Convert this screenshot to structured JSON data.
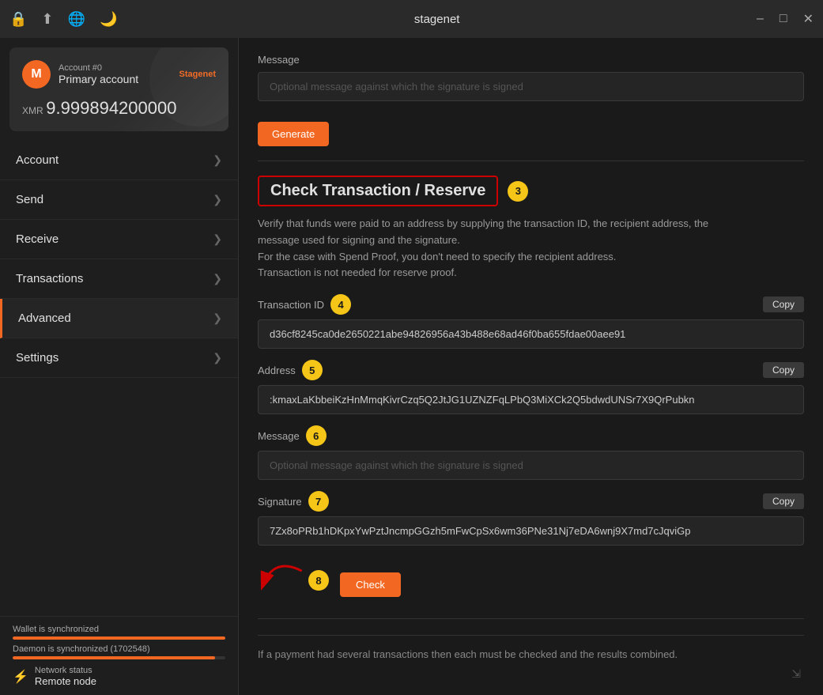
{
  "titlebar": {
    "title": "stagenet",
    "icons": [
      "lock-icon",
      "export-icon",
      "globe-icon",
      "moon-icon"
    ],
    "controls": [
      "minimize-icon",
      "maximize-icon",
      "close-icon"
    ]
  },
  "sidebar": {
    "wallet": {
      "account_num": "Account #0",
      "account_name": "Primary account",
      "network_badge": "Stagenet",
      "balance_label": "XMR",
      "balance_amount": "9.999894200000"
    },
    "nav_items": [
      {
        "label": "Account",
        "active": false
      },
      {
        "label": "Send",
        "active": false
      },
      {
        "label": "Receive",
        "active": false
      },
      {
        "label": "Transactions",
        "active": false
      },
      {
        "label": "Advanced",
        "active": true
      },
      {
        "label": "Settings",
        "active": false
      }
    ],
    "status": {
      "wallet_sync_label": "Wallet is synchronized",
      "wallet_sync_pct": 100,
      "daemon_sync_label": "Daemon is synchronized (1702548)",
      "daemon_sync_pct": 95,
      "network_label": "Network status",
      "network_value": "Remote node"
    }
  },
  "content": {
    "top_section": {
      "message_label": "Message",
      "message_placeholder": "Optional message against which the signature is signed",
      "generate_label": "Generate"
    },
    "check_tx": {
      "title": "Check Transaction / Reserve",
      "step_badge": "3",
      "description_line1": "Verify that funds were paid to an address by supplying the transaction ID, the recipient address, the",
      "description_line2": "message used for signing and the signature.",
      "description_line3": "For the case with Spend Proof, you don't need to specify the recipient address.",
      "description_line4": "Transaction is not needed for reserve proof.",
      "tx_id_label": "Transaction ID",
      "tx_id_step": "4",
      "tx_id_value": "d36cf8245ca0de2650221abe94826956a43b488e68ad46f0ba655fdae00aee91",
      "tx_id_copy": "Copy",
      "address_label": "Address",
      "address_step": "5",
      "address_value": ":kmaxLaKbbeiKzHnMmqKivrCzq5Q2JtJG1UZNZFqLPbQ3MiXCk2Q5bdwdUNSr7X9QrPubkn",
      "address_copy": "Copy",
      "message_label": "Message",
      "message_step": "6",
      "message_placeholder": "Optional message against which the signature is signed",
      "signature_label": "Signature",
      "signature_step": "7",
      "signature_value": "7Zx8oPRb1hDKpxYwPztJncmpGGzh5mFwCpSx6wm36PNe31Nj7eDA6wnj9X7md7cJqviGp",
      "signature_copy": "Copy",
      "check_label": "Check",
      "step_8_badge": "8",
      "footer_note": "If a payment had several transactions then each must be checked and the results combined."
    }
  }
}
